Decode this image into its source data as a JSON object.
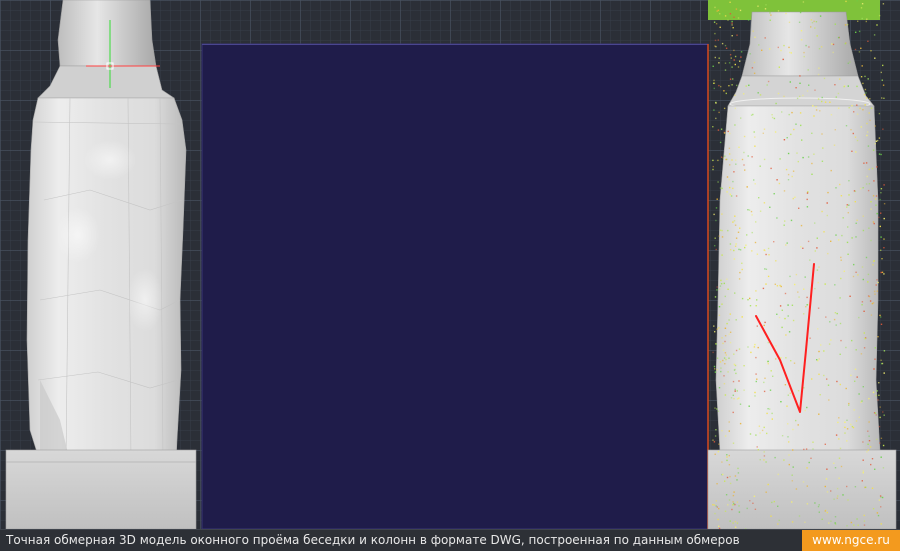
{
  "caption": {
    "text": "Точная обмерная 3D модель оконного проёма беседки и колонн в формате DWG, построенная по данным обмеров",
    "site": "www.ngce.ru"
  },
  "colors": {
    "viewport_background": "#2b2f37",
    "window_opening": "#1f1c4a",
    "column_surface": "#d9d9d9",
    "base_block": "#cfcfcf",
    "annotation_stroke": "#ff2020",
    "badge": "#f39a1e",
    "ucs_x_axis": "#ff4040",
    "ucs_y_axis": "#33dd33"
  },
  "icons": {
    "cursor": "crosshair-cursor-icon"
  }
}
